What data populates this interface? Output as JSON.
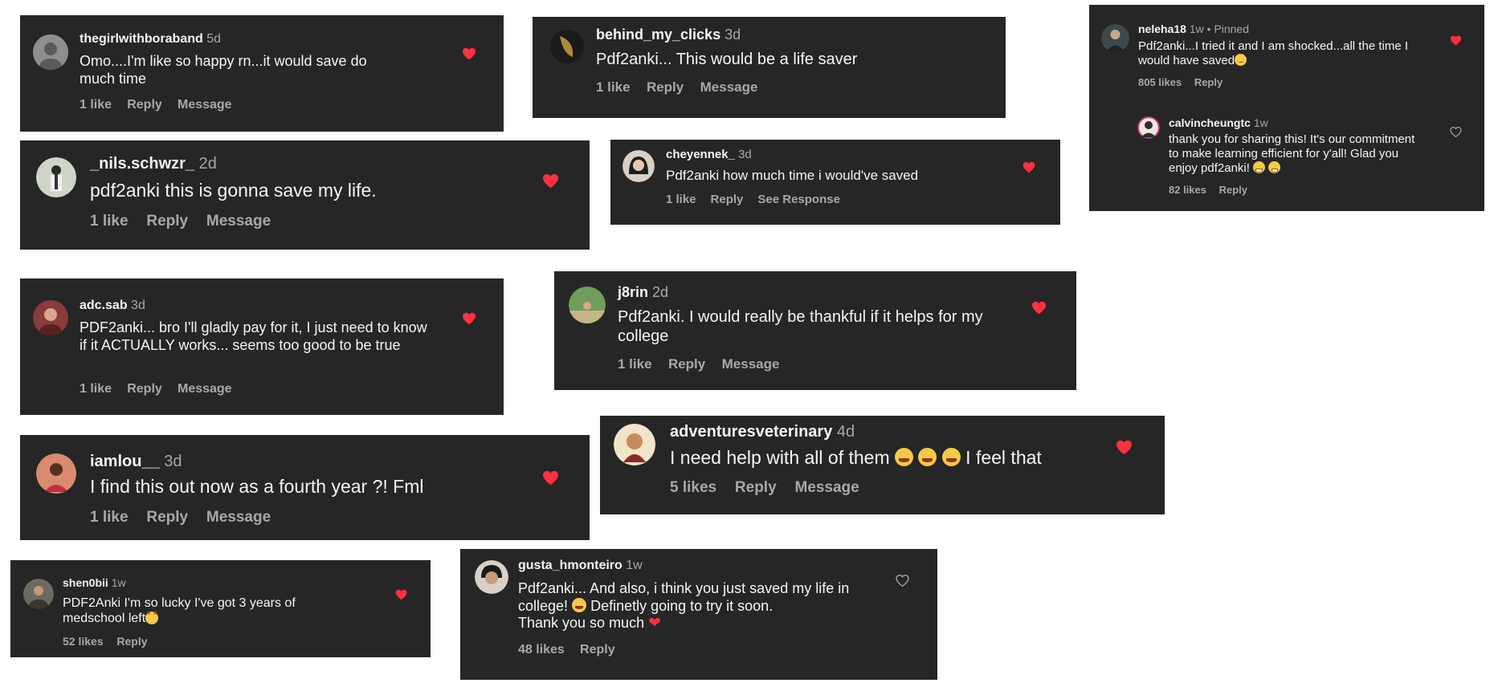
{
  "accent_heart": "#ff3040",
  "comments": [
    {
      "id": "c1",
      "username": "thegirlwithboraband",
      "time": "5d",
      "text": "Omo....I'm like so happy rn...it would save do much time",
      "likes": "1 like",
      "reply": "Reply",
      "extra": "Message",
      "heart": "filled-heart-icon"
    },
    {
      "id": "c2",
      "username": "behind_my_clicks",
      "time": "3d",
      "text": "Pdf2anki... This would be a life saver",
      "likes": "1 like",
      "reply": "Reply",
      "extra": "Message",
      "heart": "filled-heart-icon"
    },
    {
      "id": "c3",
      "username": "neleha18",
      "time": "1w",
      "pinned": "• Pinned",
      "text": "Pdf2anki...I tried it and I am shocked...all the time I would have saved",
      "likes": "805 likes",
      "reply": "Reply",
      "heart": "filled-heart-icon",
      "reply_comment": {
        "username": "calvincheungtc",
        "time": "1w",
        "text": "thank you for sharing this! It's our commitment to make learning efficient for y'all! Glad you enjoy pdf2anki!",
        "likes": "82 likes",
        "reply": "Reply",
        "heart": "outline-heart-icon"
      }
    },
    {
      "id": "c4",
      "username": "_nils.schwzr_",
      "time": "2d",
      "text": "pdf2anki this is gonna save my life.",
      "likes": "1 like",
      "reply": "Reply",
      "extra": "Message",
      "heart": "filled-heart-icon"
    },
    {
      "id": "c5",
      "username": "cheyennek_",
      "time": "3d",
      "text": "Pdf2anki how much time i would've saved",
      "likes": "1 like",
      "reply": "Reply",
      "extra": "See Response",
      "heart": "filled-heart-icon"
    },
    {
      "id": "c6",
      "username": "adc.sab",
      "time": "3d",
      "text": "PDF2anki... bro I'll gladly pay for it, I just need to know if it ACTUALLY works... seems too good to be true",
      "likes": "1 like",
      "reply": "Reply",
      "extra": "Message",
      "heart": "filled-heart-icon"
    },
    {
      "id": "c7",
      "username": "j8rin",
      "time": "2d",
      "text": "Pdf2anki. I would really be thankful if it helps for my college",
      "likes": "1 like",
      "reply": "Reply",
      "extra": "Message",
      "heart": "filled-heart-icon"
    },
    {
      "id": "c8",
      "username": "adventuresveterinary",
      "time": "4d",
      "text_a": "I need help with all of them",
      "text_b": "I feel that",
      "likes": "5 likes",
      "reply": "Reply",
      "extra": "Message",
      "heart": "filled-heart-icon"
    },
    {
      "id": "c9",
      "username": "iamlou__",
      "time": "3d",
      "text": "I find this out now as a fourth year ?! Fml",
      "likes": "1 like",
      "reply": "Reply",
      "extra": "Message",
      "heart": "filled-heart-icon"
    },
    {
      "id": "c10",
      "username": "shen0bii",
      "time": "1w",
      "text": "PDF2Anki I'm so lucky I've got 3 years of medschool left",
      "likes": "52 likes",
      "reply": "Reply",
      "heart": "filled-heart-icon"
    },
    {
      "id": "c11",
      "username": "gusta_hmonteiro",
      "time": "1w",
      "text_a": "Pdf2anki... And also, i think you just saved my life in college!",
      "text_b": "Definetly going to try it soon.",
      "text_c": "Thank you so much",
      "likes": "48 likes",
      "reply": "Reply",
      "heart": "outline-heart-icon"
    }
  ]
}
